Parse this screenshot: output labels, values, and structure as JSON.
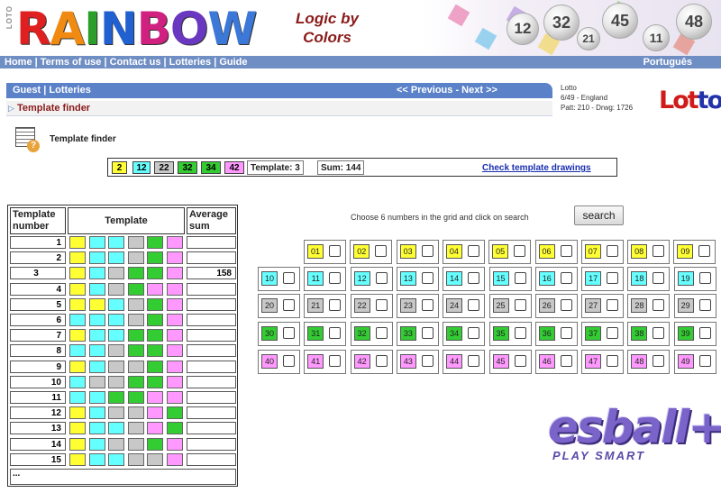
{
  "header": {
    "loto_vertical": "LOTO",
    "logo_text": "RAINBOW",
    "logo_letter_colors": [
      "#e02020",
      "#f08a10",
      "#2b9e2b",
      "#2060d0",
      "#d02080",
      "#6a38c0",
      "#3b78d8"
    ],
    "tagline_line1": "Logic by",
    "tagline_line2": "Colors",
    "balls": [
      "12",
      "32",
      "21",
      "45",
      "11",
      "48"
    ]
  },
  "nav": {
    "home": "Home",
    "terms": "Terms of use",
    "contact": "Contact us",
    "lotteries": "Lotteries",
    "guide": "Guide",
    "language": "Português"
  },
  "subbar": {
    "guest": "Guest",
    "lotteries": "Lotteries",
    "prev": "<< Previous",
    "next": "Next >>"
  },
  "breadcrumb": "Template finder",
  "lotto_info": {
    "line1": "Lotto",
    "line2": "6/49 - England",
    "line3": "Patt: 210 - Drwg: 1726",
    "logo_part1": "Lot",
    "logo_part2": "to"
  },
  "finder_title": "Template finder",
  "selection": {
    "numbers": [
      {
        "n": "2",
        "color": "#ffff33"
      },
      {
        "n": "12",
        "color": "#66ffff"
      },
      {
        "n": "22",
        "color": "#c8c8c8"
      },
      {
        "n": "32",
        "color": "#33cc33"
      },
      {
        "n": "34",
        "color": "#33cc33"
      },
      {
        "n": "42",
        "color": "#ff99ff"
      }
    ],
    "template_label": "Template: 3",
    "sum_label": "Sum: 144",
    "check_link": "Check template drawings"
  },
  "template_table": {
    "header_number": "Template number",
    "header_template": "Template",
    "header_avg": "Average sum",
    "colors": {
      "Y": "#ffff33",
      "C": "#66ffff",
      "G": "#c8c8c8",
      "N": "#33cc33",
      "P": "#ff99ff"
    },
    "rows": [
      {
        "number": "1",
        "cells": [
          "Y",
          "C",
          "C",
          "G",
          "N",
          "P"
        ],
        "avg": ""
      },
      {
        "number": "2",
        "cells": [
          "Y",
          "C",
          "C",
          "G",
          "N",
          "P"
        ],
        "avg": ""
      },
      {
        "number": "3",
        "cells": [
          "Y",
          "C",
          "G",
          "N",
          "N",
          "P"
        ],
        "avg": "158"
      },
      {
        "number": "4",
        "cells": [
          "Y",
          "C",
          "G",
          "N",
          "P",
          "P"
        ],
        "avg": ""
      },
      {
        "number": "5",
        "cells": [
          "Y",
          "Y",
          "C",
          "G",
          "N",
          "P"
        ],
        "avg": ""
      },
      {
        "number": "6",
        "cells": [
          "C",
          "C",
          "C",
          "G",
          "N",
          "P"
        ],
        "avg": ""
      },
      {
        "number": "7",
        "cells": [
          "Y",
          "C",
          "C",
          "N",
          "N",
          "P"
        ],
        "avg": ""
      },
      {
        "number": "8",
        "cells": [
          "C",
          "C",
          "G",
          "N",
          "N",
          "P"
        ],
        "avg": ""
      },
      {
        "number": "9",
        "cells": [
          "Y",
          "C",
          "G",
          "G",
          "N",
          "P"
        ],
        "avg": ""
      },
      {
        "number": "10",
        "cells": [
          "C",
          "G",
          "G",
          "N",
          "N",
          "P"
        ],
        "avg": ""
      },
      {
        "number": "11",
        "cells": [
          "C",
          "C",
          "N",
          "N",
          "P",
          "P"
        ],
        "avg": ""
      },
      {
        "number": "12",
        "cells": [
          "Y",
          "C",
          "G",
          "G",
          "P",
          "N"
        ],
        "avg": ""
      },
      {
        "number": "13",
        "cells": [
          "Y",
          "C",
          "C",
          "G",
          "P",
          "N"
        ],
        "avg": ""
      },
      {
        "number": "14",
        "cells": [
          "Y",
          "C",
          "G",
          "G",
          "N",
          "P"
        ],
        "avg": ""
      },
      {
        "number": "15",
        "cells": [
          "Y",
          "C",
          "C",
          "G",
          "G",
          "P"
        ],
        "avg": ""
      }
    ],
    "footer": "..."
  },
  "grid": {
    "instruction": "Choose 6 numbers in the grid and click on search",
    "search_label": "search",
    "row_colors": [
      "#ffff33",
      "#66ffff",
      "#c8c8c8",
      "#33cc33",
      "#ff99ff"
    ],
    "numbers": [
      [
        "01",
        "02",
        "03",
        "04",
        "05",
        "06",
        "07",
        "08",
        "09"
      ],
      [
        "10",
        "11",
        "12",
        "13",
        "14",
        "15",
        "16",
        "17",
        "18",
        "19"
      ],
      [
        "20",
        "21",
        "22",
        "23",
        "24",
        "25",
        "26",
        "27",
        "28",
        "29"
      ],
      [
        "30",
        "31",
        "32",
        "33",
        "34",
        "35",
        "36",
        "37",
        "38",
        "39"
      ],
      [
        "40",
        "41",
        "42",
        "43",
        "44",
        "45",
        "46",
        "47",
        "48",
        "49"
      ]
    ]
  },
  "brand": {
    "main": "esball+",
    "sub": "PLAY SMART"
  }
}
